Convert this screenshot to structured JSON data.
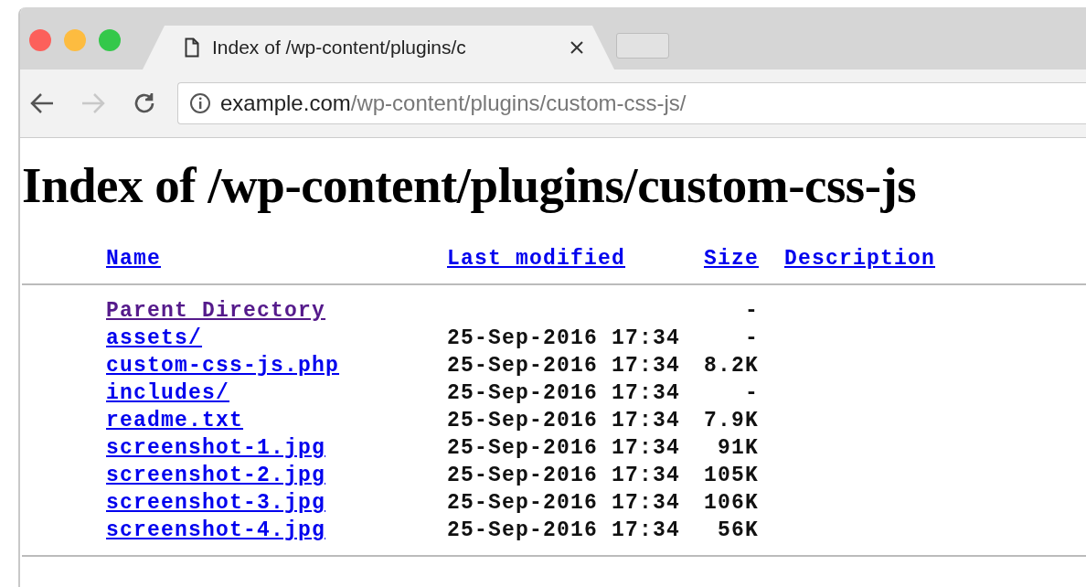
{
  "tabs": [
    {
      "title": "Index of /wp-content/plugins/c",
      "selected": true
    }
  ],
  "toolbar": {
    "back": {
      "disabled": false
    },
    "forward": {
      "disabled": true
    }
  },
  "address": {
    "host": "example.com",
    "path": "/wp-content/plugins/custom-css-js/"
  },
  "page": {
    "heading": "Index of /wp-content/plugins/custom-css-js",
    "columns": [
      "Name",
      "Last modified",
      "Size",
      "Description"
    ],
    "rows": [
      {
        "name": "Parent Directory",
        "visited": true,
        "size": "-"
      },
      {
        "name": "assets/",
        "visited": false,
        "modified": "25-Sep-2016 17:34",
        "size": "-"
      },
      {
        "name": "custom-css-js.php",
        "visited": false,
        "modified": "25-Sep-2016 17:34",
        "size": "8.2K"
      },
      {
        "name": "includes/",
        "visited": false,
        "modified": "25-Sep-2016 17:34",
        "size": "-"
      },
      {
        "name": "readme.txt",
        "visited": false,
        "modified": "25-Sep-2016 17:34",
        "size": "7.9K"
      },
      {
        "name": "screenshot-1.jpg",
        "visited": false,
        "modified": "25-Sep-2016 17:34",
        "size": "91K"
      },
      {
        "name": "screenshot-2.jpg",
        "visited": false,
        "modified": "25-Sep-2016 17:34",
        "size": "105K"
      },
      {
        "name": "screenshot-3.jpg",
        "visited": false,
        "modified": "25-Sep-2016 17:34",
        "size": "106K"
      },
      {
        "name": "screenshot-4.jpg",
        "visited": false,
        "modified": "25-Sep-2016 17:34",
        "size": "56K"
      }
    ]
  }
}
